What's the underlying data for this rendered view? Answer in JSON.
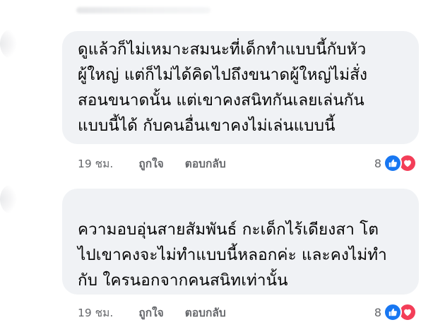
{
  "comments": [
    {
      "lines": [
        "ดูแล้วก็ไม่เหมาะสมนะที่เด็กทำแบบนี้กับหัว",
        "ผู้ใหญ่ แต่ก็ไม่ได้คิดไปถึงขนาดผู้ใหญ่ไม่สั่ง",
        "สอนขนาดนั้น แต่เขาคงสนิทกันเลยเล่นกัน",
        "แบบนี้ได้ กับคนอื่นเขาคงไม่เล่นแบบนี้"
      ],
      "time": "19 ชม.",
      "like_label": "ถูกใจ",
      "reply_label": "ตอบกลับ",
      "reaction_count": "8",
      "reactions": [
        "like-icon",
        "love-icon"
      ]
    },
    {
      "lines": [
        "ความอบอุ่นสายสัมพันธ์ กะเด็กไร้เดียงสา โต",
        "ไปเขาคงจะไม่ทำแบบนี้หลอกค่ะ และคงไม่ทำ",
        "กับ ใครนอกจากคนสนิทเท่านั้น"
      ],
      "time": "19 ชม.",
      "like_label": "ถูกใจ",
      "reply_label": "ตอบกลับ",
      "reaction_count": "8",
      "reactions": [
        "like-icon",
        "love-icon"
      ]
    }
  ],
  "colors": {
    "bubble_bg": "#f0f2f5",
    "text": "#050505",
    "meta_text": "#65676b",
    "like_blue": "#1877f2",
    "love_red": "#f33e58"
  }
}
